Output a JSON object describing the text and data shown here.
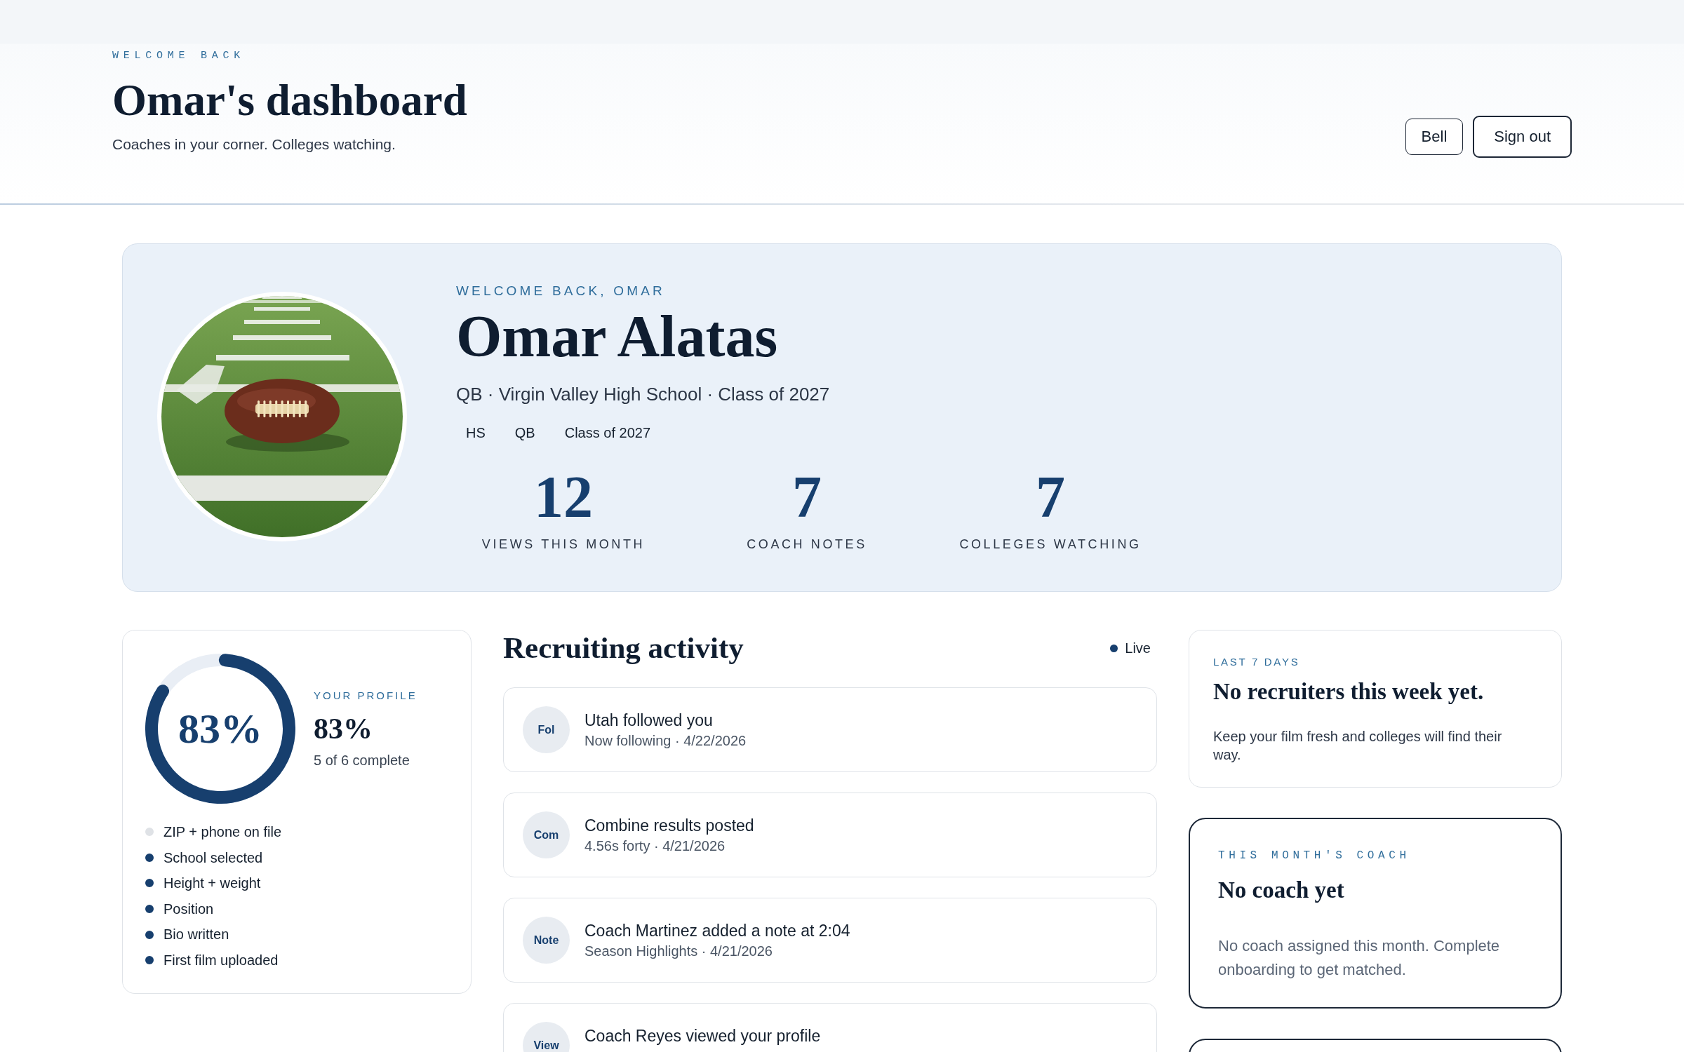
{
  "header": {
    "eyebrow": "WELCOME BACK",
    "title": "Omar's dashboard",
    "subtitle": "Coaches in your corner. Colleges watching.",
    "buttons": [
      "Bell",
      "Sign out"
    ]
  },
  "hero": {
    "eyebrow": "WELCOME BACK, OMAR",
    "name": "Omar Alatas",
    "details": "QB · Virgin Valley High School · Class of 2027",
    "tags": [
      "HS",
      "QB",
      "Class of 2027"
    ],
    "stats": [
      {
        "value": "12",
        "label": "VIEWS THIS MONTH"
      },
      {
        "value": "7",
        "label": "COACH NOTES"
      },
      {
        "value": "7",
        "label": "COLLEGES WATCHING"
      }
    ]
  },
  "profile": {
    "level": 0.83,
    "ring_label": "83%",
    "eyebrow": "YOUR PROFILE",
    "percent": "83%",
    "summary": "5 of 6 complete",
    "checklist": [
      {
        "label": "ZIP + phone on file",
        "done": false
      },
      {
        "label": "School selected",
        "done": true
      },
      {
        "label": "Height + weight",
        "done": true
      },
      {
        "label": "Position",
        "done": true
      },
      {
        "label": "Bio written",
        "done": true
      },
      {
        "label": "First film uploaded",
        "done": true
      }
    ]
  },
  "activity": {
    "title": "Recruiting activity",
    "status": "Live",
    "items": [
      {
        "badge": "Fol",
        "title": "Utah followed you",
        "detail": "Now following · 4/22/2026"
      },
      {
        "badge": "Com",
        "title": "Combine results posted",
        "detail": "4.56s forty · 4/21/2026"
      },
      {
        "badge": "Note",
        "title": "Coach Martinez added a note at 2:04",
        "detail": "Season Highlights · 4/21/2026"
      },
      {
        "badge": "View",
        "title": "Coach Reyes viewed your profile"
      }
    ]
  },
  "sidebar": {
    "cards": [
      {
        "kind": "plain",
        "eyebrow": "LAST 7 DAYS",
        "title": "No recruiters this week yet.",
        "body": "Keep your film fresh and colleges will find their way."
      },
      {
        "kind": "outlined",
        "eyebrow": "THIS MONTH'S COACH",
        "title": "No coach yet",
        "body": "No coach assigned this month. Complete onboarding to get matched."
      },
      {
        "kind": "outlined"
      }
    ]
  }
}
